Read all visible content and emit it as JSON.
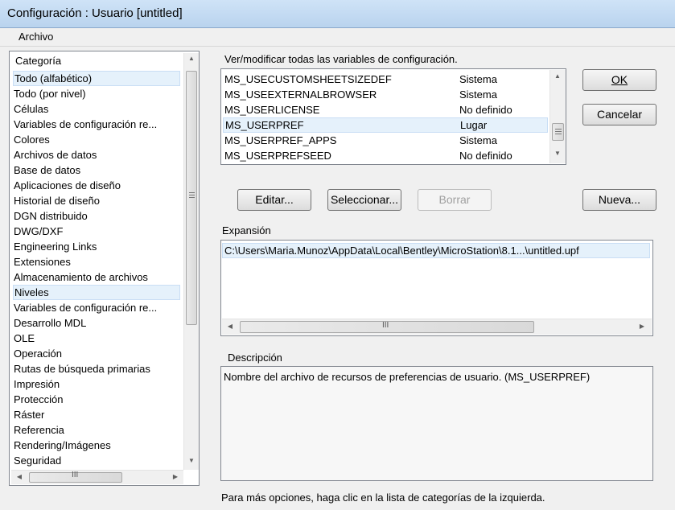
{
  "window": {
    "title": "Configuración : Usuario [untitled]"
  },
  "menu": {
    "archivo": "Archivo"
  },
  "categories": {
    "header": "Categoría",
    "items": [
      "Todo (alfabético)",
      "Todo (por nivel)",
      "Células",
      "Variables de configuración re...",
      "Colores",
      "Archivos de datos",
      "Base de datos",
      "Aplicaciones de diseño",
      "Historial de diseño",
      "DGN distribuido",
      "DWG/DXF",
      "Engineering Links",
      "Extensiones",
      "Almacenamiento de archivos",
      "Niveles",
      "Variables de configuración re...",
      "Desarrollo MDL",
      "OLE",
      "Operación",
      "Rutas de búsqueda primarias",
      "Impresión",
      "Protección",
      "Ráster",
      "Referencia",
      "Rendering/Imágenes",
      "Seguridad"
    ]
  },
  "variables": {
    "caption": "Ver/modificar todas las variables de configuración.",
    "rows": [
      {
        "name": "MS_USECUSTOMSHEETSIZEDEF",
        "level": "Sistema"
      },
      {
        "name": "MS_USEEXTERNALBROWSER",
        "level": "Sistema"
      },
      {
        "name": "MS_USERLICENSE",
        "level": "No definido"
      },
      {
        "name": "MS_USERPREF",
        "level": "Lugar"
      },
      {
        "name": "MS_USERPREF_APPS",
        "level": "Sistema"
      },
      {
        "name": "MS_USERPREFSEED",
        "level": "No definido"
      }
    ]
  },
  "buttons": {
    "ok": "OK",
    "cancel": "Cancelar",
    "edit": "Editar...",
    "select": "Seleccionar...",
    "delete": "Borrar",
    "new": "Nueva..."
  },
  "expansion": {
    "label": "Expansión",
    "value": "C:\\Users\\Maria.Munoz\\AppData\\Local\\Bentley\\MicroStation\\8.1...\\untitled.upf"
  },
  "description": {
    "label": "Descripción",
    "text": "Nombre del archivo de recursos de preferencias de usuario. (MS_USERPREF)"
  },
  "footer": {
    "hint": "Para más opciones, haga clic en la lista de categorías de la izquierda."
  }
}
